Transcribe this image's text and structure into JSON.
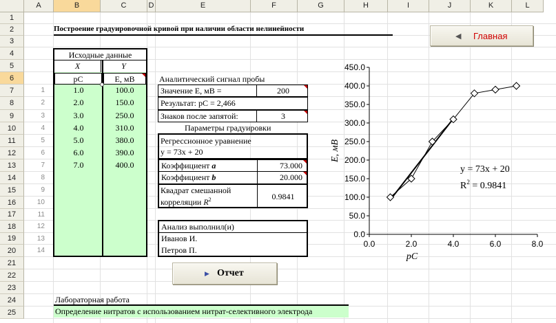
{
  "columns": [
    "A",
    "B",
    "C",
    "D",
    "E",
    "F",
    "G",
    "H",
    "I",
    "J",
    "K",
    "L"
  ],
  "rows": [
    "1",
    "2",
    "3",
    "4",
    "5",
    "6",
    "7",
    "8",
    "9",
    "10",
    "11",
    "12",
    "13",
    "14",
    "15",
    "16",
    "17",
    "18",
    "19",
    "20",
    "21",
    "22",
    "23",
    "24",
    "25"
  ],
  "title": "Построение градуировочной кривой при наличии области нелинейности",
  "main_button": "Главная",
  "report_button": "Отчет",
  "source": {
    "header": "Исходные данные",
    "x_label": "X",
    "y_label": "Y",
    "x_name": "pC",
    "y_name": "E, мВ",
    "rows": [
      {
        "idx": "1",
        "x": "1.0",
        "y": "100.0"
      },
      {
        "idx": "2",
        "x": "2.0",
        "y": "150.0"
      },
      {
        "idx": "3",
        "x": "3.0",
        "y": "250.0"
      },
      {
        "idx": "4",
        "x": "4.0",
        "y": "310.0"
      },
      {
        "idx": "5",
        "x": "5.0",
        "y": "380.0"
      },
      {
        "idx": "6",
        "x": "6.0",
        "y": "390.0"
      },
      {
        "idx": "7",
        "x": "7.0",
        "y": "400.0"
      }
    ],
    "empty_idx": [
      "8",
      "9",
      "10",
      "11",
      "12",
      "13",
      "14"
    ]
  },
  "signal": {
    "header": "Аналитический сигнал пробы",
    "value_label": "Значение E, мВ =",
    "value": "200",
    "result_label": "Результат: pC = 2,466",
    "digits_label": "Знаков после запятой:",
    "digits": "3"
  },
  "calib": {
    "header": "Параметры градуировки",
    "eq_label": "Регрессионное уравнение",
    "eq": "y = 73x + 20",
    "coef_a_label": "Коэффициент ",
    "coef_a_sym": "a",
    "coef_a": "73.000",
    "coef_b_label": "Коэффициент ",
    "coef_b_sym": "b",
    "coef_b": "20.000",
    "r2_label_1": "Квадрат смешанной",
    "r2_label_2": "корреляции ",
    "r2_sym": "R",
    "r2_exp": "2",
    "r2": "0.9841"
  },
  "analysts": {
    "header": "Анализ выполнил(и)",
    "names": [
      "Иванов И.",
      "Петров П."
    ]
  },
  "lab": {
    "label": "Лабораторная работа",
    "name": "Определение нитратов с использованием нитрат-селективного электрода"
  },
  "colors": {
    "green": "#ccffcc",
    "header_sel": "#f9d99b",
    "red": "#c00000"
  },
  "chart_data": {
    "type": "scatter",
    "x": [
      1,
      2,
      3,
      4,
      5,
      6,
      7
    ],
    "y": [
      100,
      150,
      250,
      310,
      380,
      390,
      400
    ],
    "trendline": {
      "slope": 73,
      "intercept": 20,
      "x_range": [
        1,
        4
      ]
    },
    "xlabel": "pC",
    "ylabel": "E, мВ",
    "xlim": [
      0,
      8
    ],
    "ylim": [
      0,
      450
    ],
    "x_ticks": [
      "0.0",
      "2.0",
      "4.0",
      "6.0",
      "8.0"
    ],
    "y_ticks": [
      "0.0",
      "50.0",
      "100.0",
      "150.0",
      "200.0",
      "250.0",
      "300.0",
      "350.0",
      "400.0",
      "450.0"
    ],
    "annotation_eq": "y = 73x + 20",
    "annotation_r2_prefix": "R",
    "annotation_r2_exp": "2",
    "annotation_r2_value": " = 0.9841"
  }
}
